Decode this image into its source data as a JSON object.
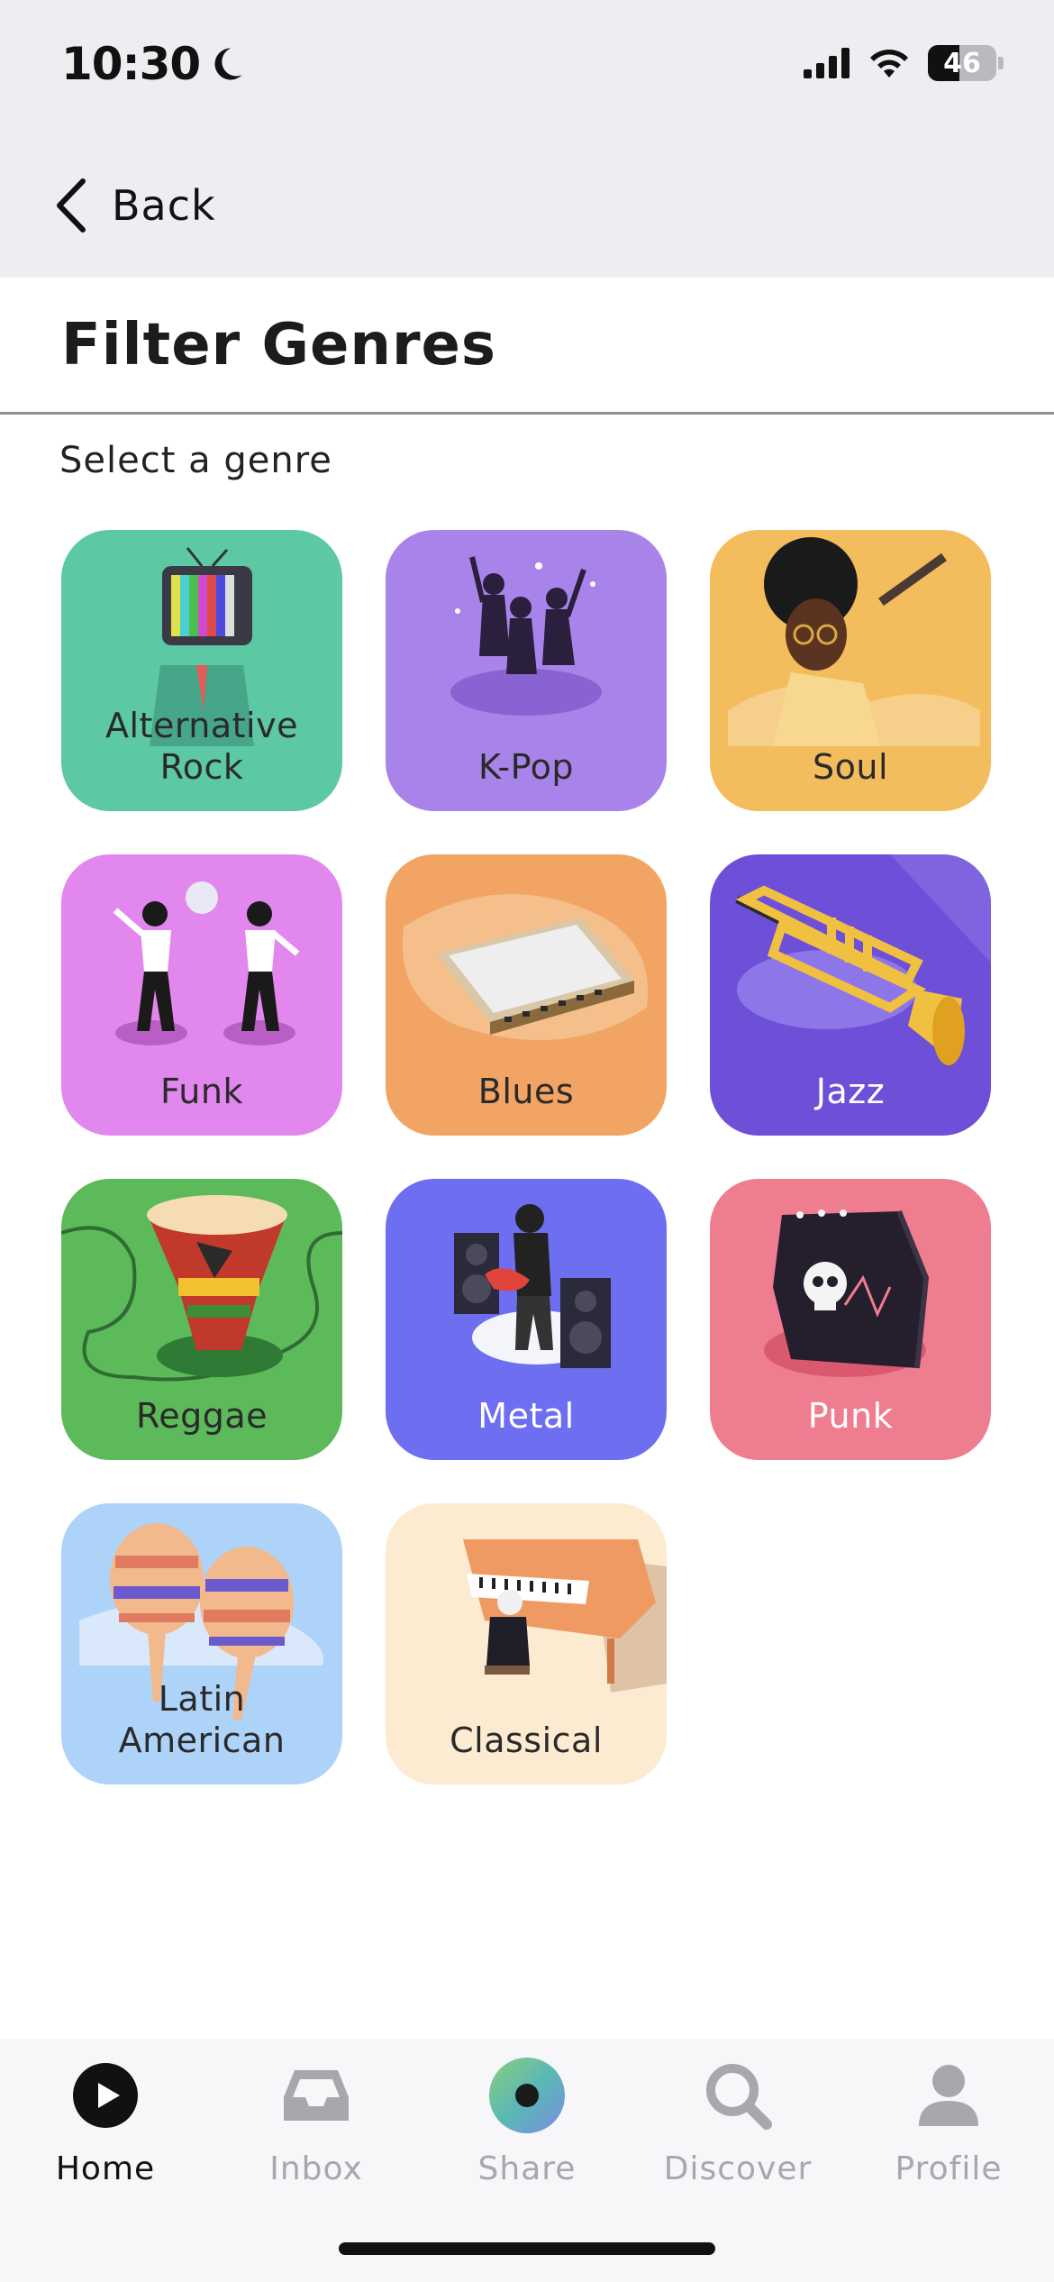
{
  "status_bar": {
    "time": "10:30",
    "battery_level": "46",
    "battery_fraction": 0.46
  },
  "nav": {
    "back_label": "Back"
  },
  "page": {
    "title": "Filter Genres",
    "subtitle": "Select a genre"
  },
  "genres": [
    {
      "label": "Alternative\nRock",
      "color": "#5cc8a4",
      "light": false
    },
    {
      "label": "K-Pop",
      "color": "#a884ea",
      "light": false
    },
    {
      "label": "Soul",
      "color": "#f3bc5c",
      "light": false
    },
    {
      "label": "Funk",
      "color": "#e287ee",
      "light": false
    },
    {
      "label": "Blues",
      "color": "#f1a463",
      "light": false
    },
    {
      "label": "Jazz",
      "color": "#6e4fd8",
      "light": true
    },
    {
      "label": "Reggae",
      "color": "#5cba5a",
      "light": false
    },
    {
      "label": "Metal",
      "color": "#6e6ef0",
      "light": true
    },
    {
      "label": "Punk",
      "color": "#ef7d90",
      "light": true
    },
    {
      "label": "Latin\nAmerican",
      "color": "#aed3f8",
      "light": false
    },
    {
      "label": "Classical",
      "color": "#fcebd1",
      "light": false
    }
  ],
  "tabs": [
    {
      "label": "Home",
      "icon": "play-circle-icon",
      "active": true
    },
    {
      "label": "Inbox",
      "icon": "inbox-tray-icon",
      "active": false
    },
    {
      "label": "Share",
      "icon": "share-orb-icon",
      "active": false
    },
    {
      "label": "Discover",
      "icon": "magnifier-icon",
      "active": false
    },
    {
      "label": "Profile",
      "icon": "person-icon",
      "active": false
    }
  ]
}
